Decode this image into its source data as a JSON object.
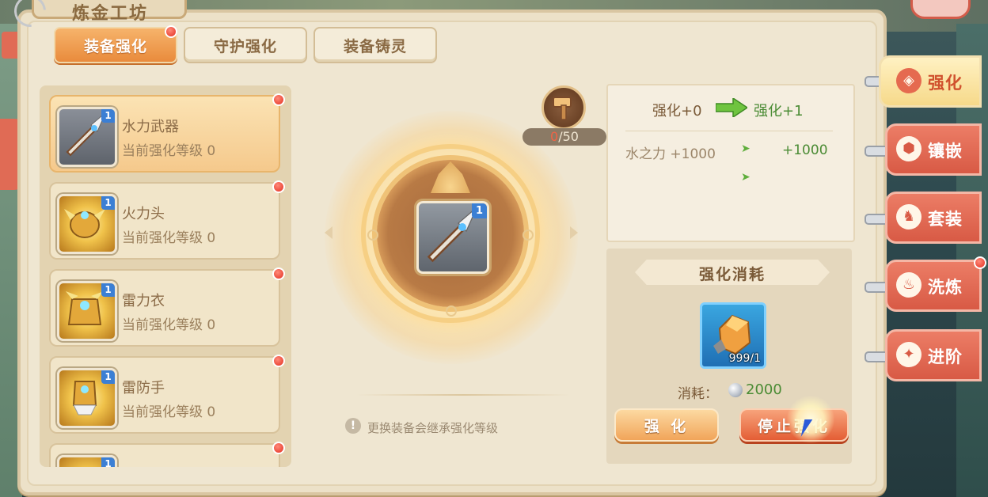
{
  "window_title": "炼金工坊",
  "tabs": [
    {
      "label": "装备强化",
      "active": true,
      "red_dot": true
    },
    {
      "label": "守护强化",
      "active": false,
      "red_dot": false
    },
    {
      "label": "装备铸灵",
      "active": false,
      "red_dot": false
    }
  ],
  "equipment_list": [
    {
      "name": "水力武器",
      "level_text": "当前强化等级 0",
      "badge": "1",
      "icon": "sword-icon",
      "selected": true
    },
    {
      "name": "火力头",
      "level_text": "当前强化等级 0",
      "badge": "1",
      "icon": "helmet-icon",
      "selected": false
    },
    {
      "name": "雷力衣",
      "level_text": "当前强化等级 0",
      "badge": "1",
      "icon": "armor-icon",
      "selected": false
    },
    {
      "name": "雷防手",
      "level_text": "当前强化等级 0",
      "badge": "1",
      "icon": "glove-icon",
      "selected": false
    },
    {
      "name": "",
      "level_text": "",
      "badge": "1",
      "icon": "item-icon",
      "selected": false
    }
  ],
  "center": {
    "item_badge": "1",
    "hammer_current": "0",
    "hammer_max": "/50",
    "hint": "更换装备会继承强化等级"
  },
  "stats": {
    "from_label": "强化+0",
    "to_label": "强化+1",
    "attr_name": "水之力 +1000",
    "attr_next": "+1000"
  },
  "cost": {
    "title": "强化消耗",
    "material_count": "999/1",
    "label": "消耗：",
    "value": "2000"
  },
  "buttons": {
    "upgrade": "强 化",
    "stop": "停止强化"
  },
  "side_nav": [
    {
      "label": "强化",
      "icon": "enhance-icon",
      "active": true,
      "red_dot": false
    },
    {
      "label": "镶嵌",
      "icon": "inlay-icon",
      "active": false,
      "red_dot": false
    },
    {
      "label": "套装",
      "icon": "set-icon",
      "active": false,
      "red_dot": false
    },
    {
      "label": "洗炼",
      "icon": "refine-icon",
      "active": false,
      "red_dot": true
    },
    {
      "label": "进阶",
      "icon": "advance-icon",
      "active": false,
      "red_dot": false
    }
  ],
  "colors": {
    "accent_orange": "#e98b3c",
    "green_value": "#4a8b34",
    "red_dot": "#e42f20",
    "tab_red": "#d85a45"
  }
}
